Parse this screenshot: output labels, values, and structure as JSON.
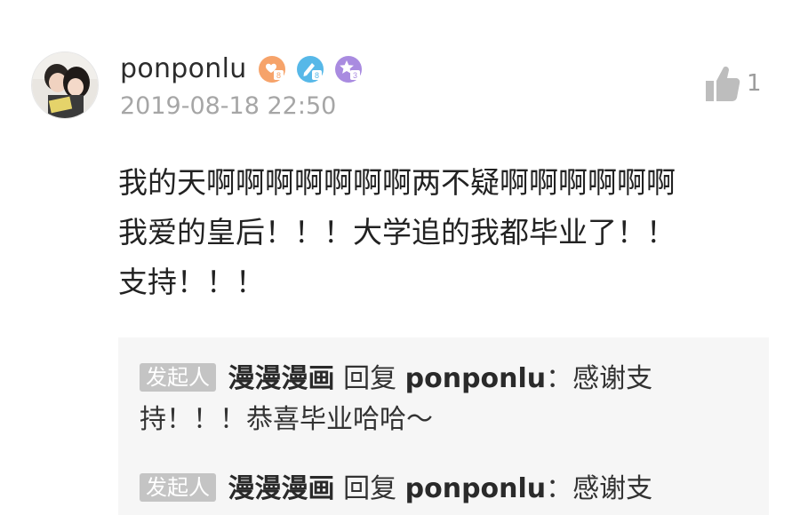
{
  "comment": {
    "username": "ponponlu",
    "timestamp": "2019-08-18 22:50",
    "like_count": "1",
    "text": "我的天啊啊啊啊啊啊啊两不疑啊啊啊啊啊啊\n我爱的皇后！！！大学追的我都毕业了！！\n支持！！！",
    "badges": [
      "heart-level-badge",
      "pencil-level-badge",
      "star-level-badge"
    ],
    "badge_colors": {
      "heart": "#f6a36a",
      "pencil": "#57b8e8",
      "star": "#a98be0"
    }
  },
  "replies": [
    {
      "tag": "发起人",
      "author": "漫漫漫画",
      "reply_word": "回复",
      "target": "ponponlu",
      "text": "：感谢支持！！！恭喜毕业哈哈～"
    },
    {
      "tag": "发起人",
      "author": "漫漫漫画",
      "reply_word": "回复",
      "target": "ponponlu",
      "text": "：感谢支"
    }
  ]
}
